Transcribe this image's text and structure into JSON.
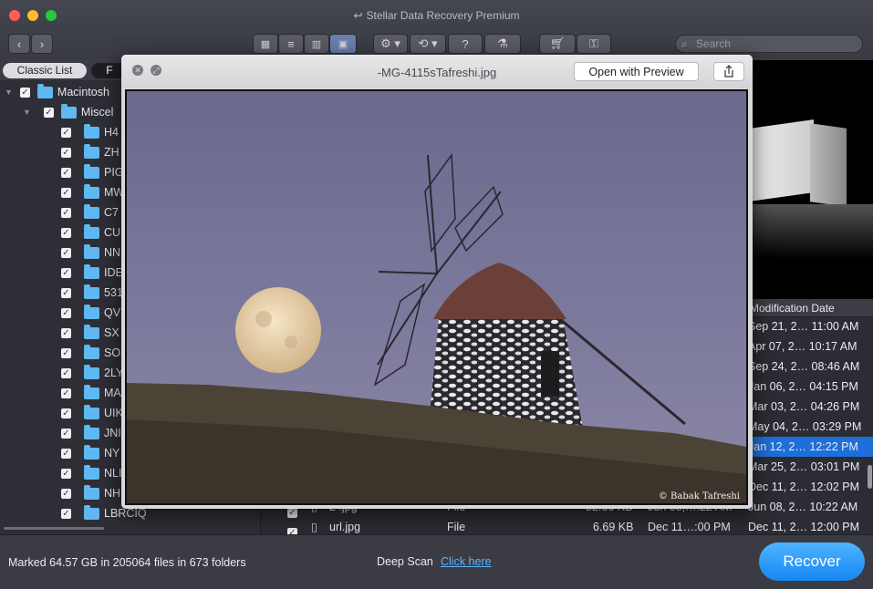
{
  "window": {
    "title": "Stellar Data Recovery Premium"
  },
  "toolbar": {
    "search_placeholder": "Search",
    "help_label": "?"
  },
  "sidebar": {
    "tabs": [
      "Classic List",
      "F"
    ],
    "root": "Macintosh",
    "folder": "Miscel",
    "items": [
      "H4",
      "ZH",
      "PIG",
      "MW",
      "C7",
      "CU",
      "NN",
      "IDE",
      "531",
      "QV",
      "SX",
      "SO",
      "2LY",
      "MA",
      "UIK",
      "JNI",
      "NY",
      "NLI",
      "NH",
      "LBRCIQ"
    ]
  },
  "preview": {
    "filename": "-MG-4115sTafreshi.jpg",
    "open_button": "Open with Preview",
    "watermark": "© Babak Tafreshi"
  },
  "file_list": {
    "column_header": "Modification Date",
    "dates": [
      "Sep 21, 2… 11:00 AM",
      "Apr 07, 2… 10:17 AM",
      "Sep 24, 2… 08:46 AM",
      "Jan 06, 2… 04:15 PM",
      "Mar 03, 2… 04:26 PM",
      "May 04, 2… 03:29 PM",
      "Jan 12, 2… 12:22 PM",
      "Mar 25, 2… 03:01 PM",
      "Dec 11, 2… 12:02 PM",
      "Jun 08, 2… 10:22 AM",
      "Dec 11, 2… 12:00 PM"
    ],
    "partial_row": {
      "name": "2 .jpg",
      "kind": "File",
      "size": "52.66 KB",
      "date": "Jun 08,…:22 AM"
    },
    "last_row": {
      "name": "url.jpg",
      "kind": "File",
      "size": "6.69 KB",
      "date": "Dec 11…:00 PM"
    }
  },
  "status": {
    "marked": "Marked 64.57 GB in 205064 files in 673 folders",
    "deep_scan": "Deep Scan",
    "click_here": "Click here",
    "recover": "Recover"
  },
  "colors": {
    "accent": "#1a8cf5",
    "folder": "#5fb8f1",
    "selected_row": "#1e6fd9"
  }
}
